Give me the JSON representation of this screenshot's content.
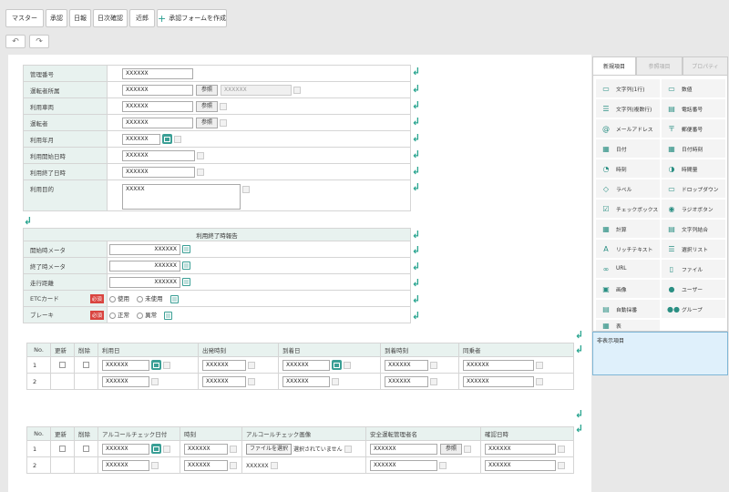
{
  "toolbar": {
    "master": "マスター",
    "approval": "承認",
    "daily": "日報",
    "daily_check": "日次確認",
    "near": "近郎",
    "create_form": "承認フォームを作成"
  },
  "form1": {
    "rows": [
      {
        "label": "管理番号",
        "value": "XXXXXX"
      },
      {
        "label": "運転者所属",
        "value": "XXXXXX",
        "ref": "参照",
        "extra": "XXXXXX"
      },
      {
        "label": "利用車両",
        "value": "XXXXXX",
        "ref": "参照"
      },
      {
        "label": "運転者",
        "value": "XXXXXX",
        "ref": "参照"
      },
      {
        "label": "利用年月",
        "value": "XXXXXX"
      },
      {
        "label": "利用開始日時",
        "value": "XXXXXX"
      },
      {
        "label": "利用終了日時",
        "value": "XXXXXX"
      },
      {
        "label": "利用目的",
        "value": "XXXXX"
      }
    ]
  },
  "form2": {
    "title": "利用終了時報告",
    "rows": [
      {
        "label": "開始時メータ",
        "value": "XXXXXX"
      },
      {
        "label": "終了時メータ",
        "value": "XXXXXX"
      },
      {
        "label": "走行距離",
        "value": "XXXXXX"
      }
    ],
    "etc": {
      "label": "ETCカード",
      "req": "必須",
      "opt1": "使用",
      "opt2": "未使用"
    },
    "brake": {
      "label": "ブレーキ",
      "req": "必須",
      "opt1": "正常",
      "opt2": "異常"
    }
  },
  "grid1": {
    "headers": [
      "No.",
      "更新",
      "削除",
      "利用日",
      "出発時刻",
      "到着日",
      "到着時刻",
      "同乗者"
    ],
    "rows": [
      {
        "no": "1",
        "c1": "XXXXXX",
        "c2": "XXXXXX",
        "c3": "XXXXXX",
        "c4": "XXXXXX",
        "c5": "XXXXXX"
      },
      {
        "no": "2",
        "c1": "XXXXXX",
        "c2": "XXXXXX",
        "c3": "XXXXXX",
        "c4": "XXXXXX",
        "c5": "XXXXXX"
      }
    ]
  },
  "grid2": {
    "headers": [
      "No.",
      "更新",
      "削除",
      "アルコールチェック日付",
      "時刻",
      "アルコールチェック画像",
      "安全運転管理者名",
      "確認日時"
    ],
    "file_button": "ファイルを選択",
    "file_status": "選択されていません",
    "ref": "参照",
    "rows": [
      {
        "no": "1",
        "c1": "XXXXXX",
        "c2": "XXXXXX",
        "c4": "XXXXXX",
        "c5": "XXXXXX"
      },
      {
        "no": "2",
        "c1": "XXXXXX",
        "c2": "XXXXXX",
        "c3": "XXXXXX",
        "c4": "XXXXXX",
        "c5": "XXXXXX"
      }
    ]
  },
  "panel": {
    "tabs": [
      "新規項目",
      "参照項目",
      "プロパティ"
    ],
    "items": [
      {
        "label": "文字列(1行)",
        "icon": "text-line-icon"
      },
      {
        "label": "数値",
        "icon": "number-icon"
      },
      {
        "label": "文字列(複数行)",
        "icon": "text-multi-icon"
      },
      {
        "label": "電話番号",
        "icon": "phone-icon"
      },
      {
        "label": "メールアドレス",
        "icon": "at-icon"
      },
      {
        "label": "郵便番号",
        "icon": "postal-icon"
      },
      {
        "label": "日付",
        "icon": "date-icon"
      },
      {
        "label": "日付時刻",
        "icon": "datetime-icon"
      },
      {
        "label": "時刻",
        "icon": "clock-icon"
      },
      {
        "label": "時間量",
        "icon": "duration-icon"
      },
      {
        "label": "ラベル",
        "icon": "tag-icon"
      },
      {
        "label": "ドロップダウン",
        "icon": "dropdown-icon"
      },
      {
        "label": "チェックボックス",
        "icon": "checkbox-icon"
      },
      {
        "label": "ラジオボタン",
        "icon": "radio-icon"
      },
      {
        "label": "計算",
        "icon": "calc-icon"
      },
      {
        "label": "文字列結合",
        "icon": "concat-icon"
      },
      {
        "label": "リッチテキスト",
        "icon": "richtext-icon"
      },
      {
        "label": "選択リスト",
        "icon": "list-icon"
      },
      {
        "label": "URL",
        "icon": "link-icon"
      },
      {
        "label": "ファイル",
        "icon": "file-icon"
      },
      {
        "label": "画像",
        "icon": "image-icon"
      },
      {
        "label": "ユーザー",
        "icon": "user-icon"
      },
      {
        "label": "自動採番",
        "icon": "autonumber-icon"
      },
      {
        "label": "グループ",
        "icon": "group-icon"
      },
      {
        "label": "表",
        "icon": "table-icon"
      }
    ],
    "hidden_label": "非表示項目"
  }
}
